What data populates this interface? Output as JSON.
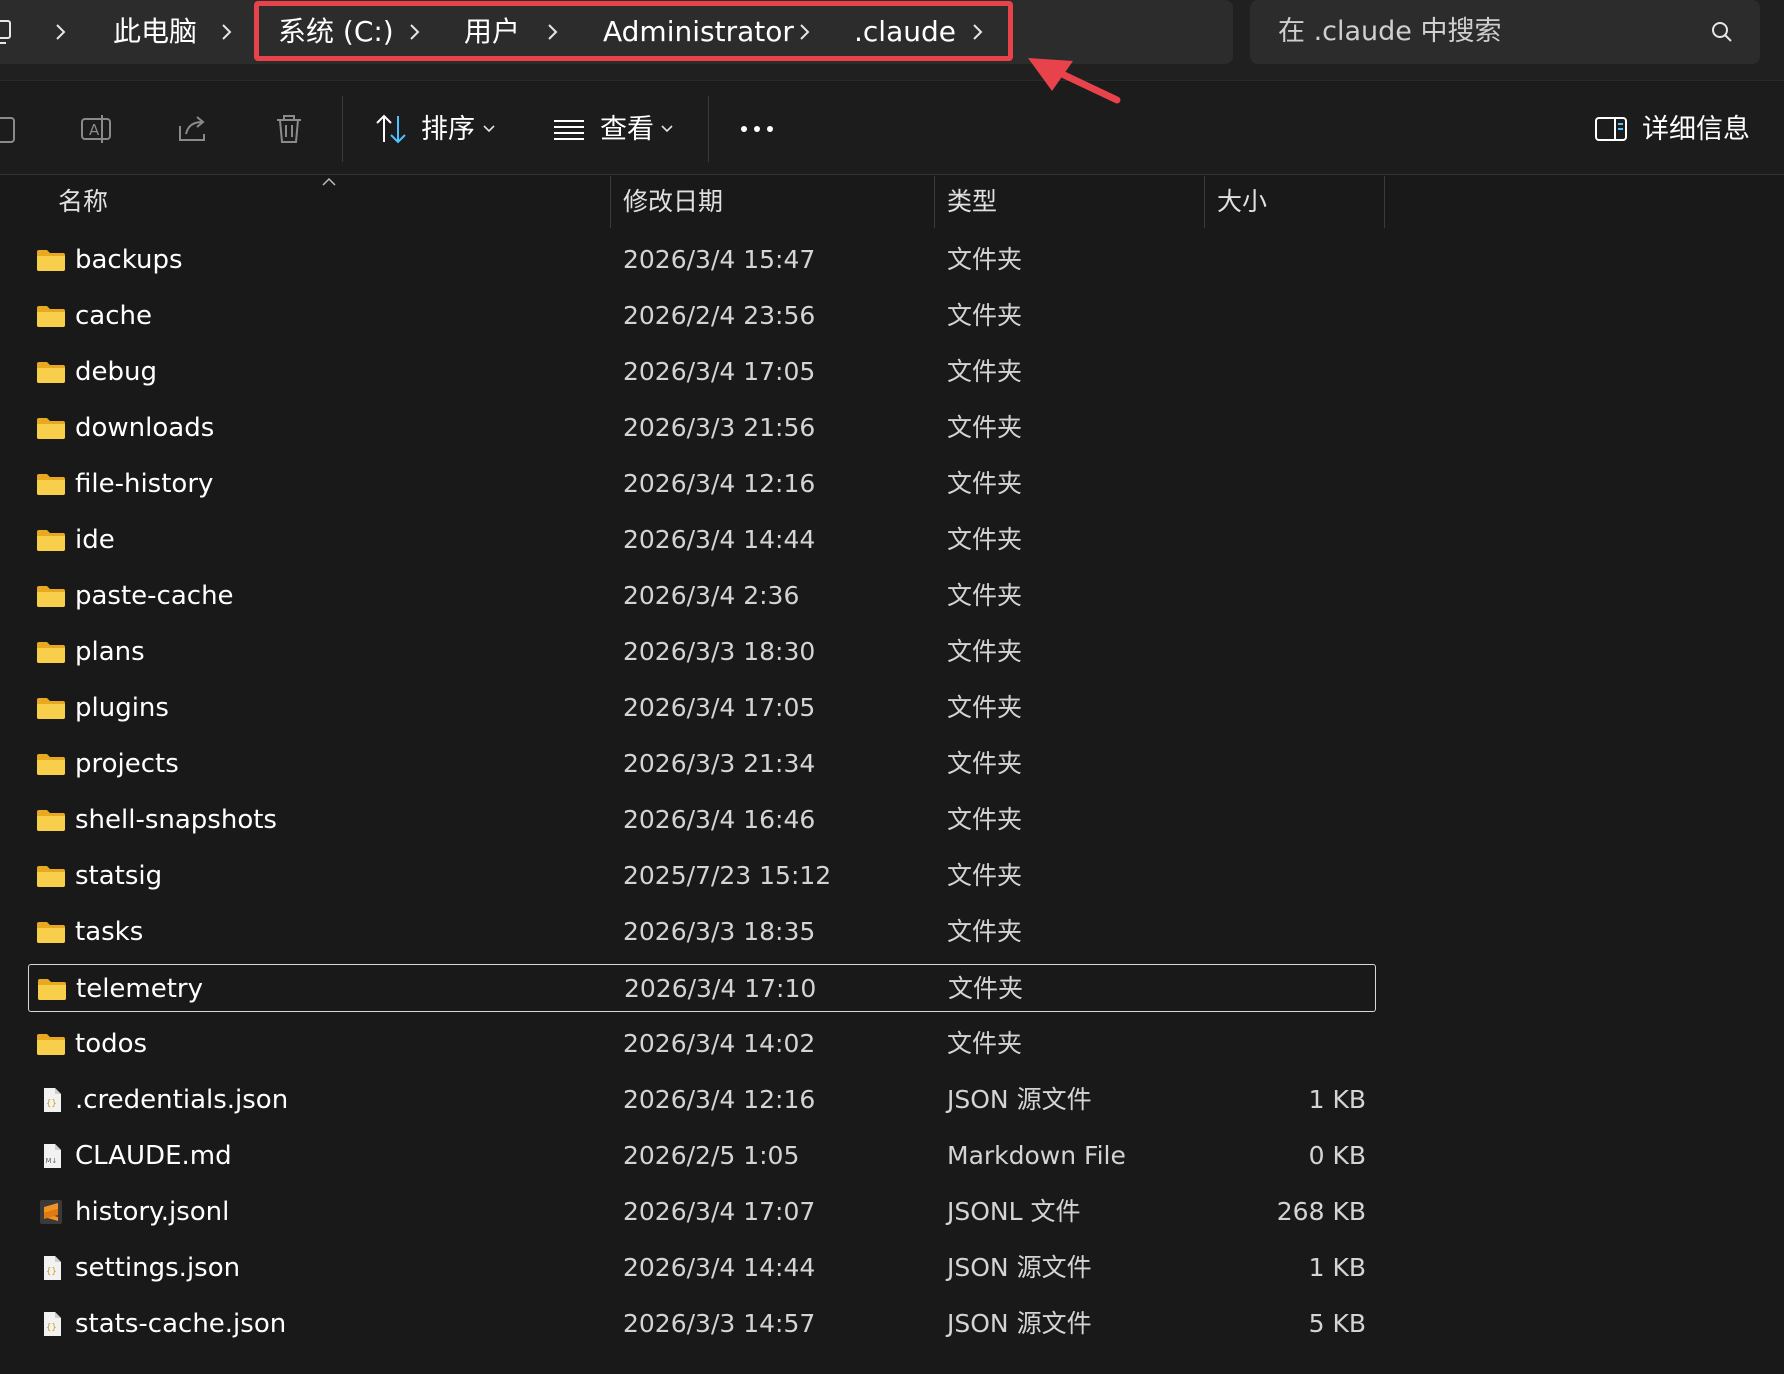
{
  "breadcrumb": {
    "items": [
      {
        "label": "此电脑"
      },
      {
        "label": "系统 (C:)"
      },
      {
        "label": "用户"
      },
      {
        "label": "Administrator"
      },
      {
        "label": ".claude"
      }
    ]
  },
  "search": {
    "placeholder": "在 .claude 中搜索"
  },
  "toolbar": {
    "sort_label": "排序",
    "view_label": "查看",
    "details_label": "详细信息"
  },
  "columns": {
    "name": "名称",
    "modified": "修改日期",
    "type": "类型",
    "size": "大小"
  },
  "files": [
    {
      "name": "backups",
      "modified": "2026/3/4 15:47",
      "type": "文件夹",
      "size": "",
      "icon": "folder-icon"
    },
    {
      "name": "cache",
      "modified": "2026/2/4 23:56",
      "type": "文件夹",
      "size": "",
      "icon": "folder-icon"
    },
    {
      "name": "debug",
      "modified": "2026/3/4 17:05",
      "type": "文件夹",
      "size": "",
      "icon": "folder-icon"
    },
    {
      "name": "downloads",
      "modified": "2026/3/3 21:56",
      "type": "文件夹",
      "size": "",
      "icon": "folder-icon"
    },
    {
      "name": "file-history",
      "modified": "2026/3/4 12:16",
      "type": "文件夹",
      "size": "",
      "icon": "folder-icon"
    },
    {
      "name": "ide",
      "modified": "2026/3/4 14:44",
      "type": "文件夹",
      "size": "",
      "icon": "folder-icon"
    },
    {
      "name": "paste-cache",
      "modified": "2026/3/4 2:36",
      "type": "文件夹",
      "size": "",
      "icon": "folder-icon"
    },
    {
      "name": "plans",
      "modified": "2026/3/3 18:30",
      "type": "文件夹",
      "size": "",
      "icon": "folder-icon"
    },
    {
      "name": "plugins",
      "modified": "2026/3/4 17:05",
      "type": "文件夹",
      "size": "",
      "icon": "folder-icon"
    },
    {
      "name": "projects",
      "modified": "2026/3/3 21:34",
      "type": "文件夹",
      "size": "",
      "icon": "folder-icon"
    },
    {
      "name": "shell-snapshots",
      "modified": "2026/3/4 16:46",
      "type": "文件夹",
      "size": "",
      "icon": "folder-icon"
    },
    {
      "name": "statsig",
      "modified": "2025/7/23 15:12",
      "type": "文件夹",
      "size": "",
      "icon": "folder-icon"
    },
    {
      "name": "tasks",
      "modified": "2026/3/3 18:35",
      "type": "文件夹",
      "size": "",
      "icon": "folder-icon"
    },
    {
      "name": "telemetry",
      "modified": "2026/3/4 17:10",
      "type": "文件夹",
      "size": "",
      "icon": "folder-icon",
      "selected": true
    },
    {
      "name": "todos",
      "modified": "2026/3/4 14:02",
      "type": "文件夹",
      "size": "",
      "icon": "folder-icon"
    },
    {
      "name": ".credentials.json",
      "modified": "2026/3/4 12:16",
      "type": "JSON 源文件",
      "size": "1 KB",
      "icon": "json-file-icon"
    },
    {
      "name": "CLAUDE.md",
      "modified": "2026/2/5 1:05",
      "type": "Markdown File",
      "size": "0 KB",
      "icon": "markdown-file-icon"
    },
    {
      "name": "history.jsonl",
      "modified": "2026/3/4 17:07",
      "type": "JSONL 文件",
      "size": "268 KB",
      "icon": "sublime-file-icon"
    },
    {
      "name": "settings.json",
      "modified": "2026/3/4 14:44",
      "type": "JSON 源文件",
      "size": "1 KB",
      "icon": "json-file-icon"
    },
    {
      "name": "stats-cache.json",
      "modified": "2026/3/3 14:57",
      "type": "JSON 源文件",
      "size": "5 KB",
      "icon": "json-file-icon"
    }
  ],
  "colors": {
    "background": "#191919",
    "bar": "#2c2c2c",
    "folder": "#f4c23d",
    "annotation": "#e8424a"
  }
}
